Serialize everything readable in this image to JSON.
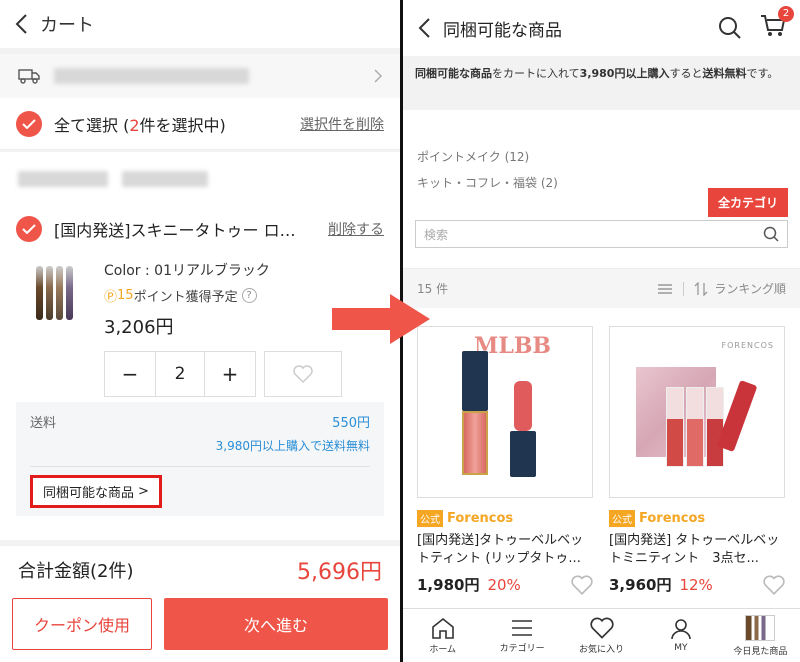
{
  "left": {
    "header": {
      "title": "カート"
    },
    "select_all": {
      "prefix": "全て選択 (",
      "count": "2",
      "suffix": "件を選択中)",
      "delete_label": "選択件を削除"
    },
    "item": {
      "name": "[国内発送]スキニータトゥー ロングラ...",
      "delete_label": "削除する",
      "color": "Color : 01リアルブラック",
      "points_icon": "Ⓟ",
      "points_value": "15",
      "points_text": "ポイント獲得予定",
      "help": "?",
      "price": "3,206円",
      "qty": "2",
      "minus": "−",
      "plus": "+"
    },
    "shipping": {
      "label": "送料",
      "value": "550円",
      "note": "3,980円以上購入で送料無料",
      "bundle_button": "同梱可能な商品",
      "bundle_chevron": ">"
    },
    "total": {
      "label": "合計金額(2件)",
      "value": "5,696円"
    },
    "buttons": {
      "coupon": "クーポン使用",
      "next": "次へ進む"
    }
  },
  "right": {
    "header": {
      "title": "同梱可能な商品",
      "cart_count": "2"
    },
    "banner": {
      "p1": "同梱可能な商品",
      "p2": "をカートに入れて",
      "p3": "3,980円以上購入",
      "p4": "すると",
      "p5": "送料無料",
      "p6": "です。"
    },
    "categories": [
      "ポイントメイク (12)",
      "キット・コフレ・福袋 (2)"
    ],
    "all_categories": "全カテゴリ",
    "search_placeholder": "検索",
    "count": "15 件",
    "sort": "ランキング順",
    "products": [
      {
        "official": "公式",
        "brand": "Forencos",
        "name": "[国内発送]タトゥーベルベットティント (リップタトゥ...",
        "price": "1,980円",
        "discount": "20%",
        "img_text": "MLBB"
      },
      {
        "official": "公式",
        "brand": "Forencos",
        "name": "[国内発送] タトゥーベルベットミニティント　3点セ...",
        "price": "3,960円",
        "discount": "12%",
        "img_text": "FORENCOS"
      }
    ],
    "nav": [
      "ホーム",
      "カテゴリー",
      "お気に入り",
      "MY",
      "今日見た商品"
    ],
    "colors": {
      "accent": "#e8453c",
      "brand": "#f5a623",
      "link": "#2a8fd6"
    }
  }
}
